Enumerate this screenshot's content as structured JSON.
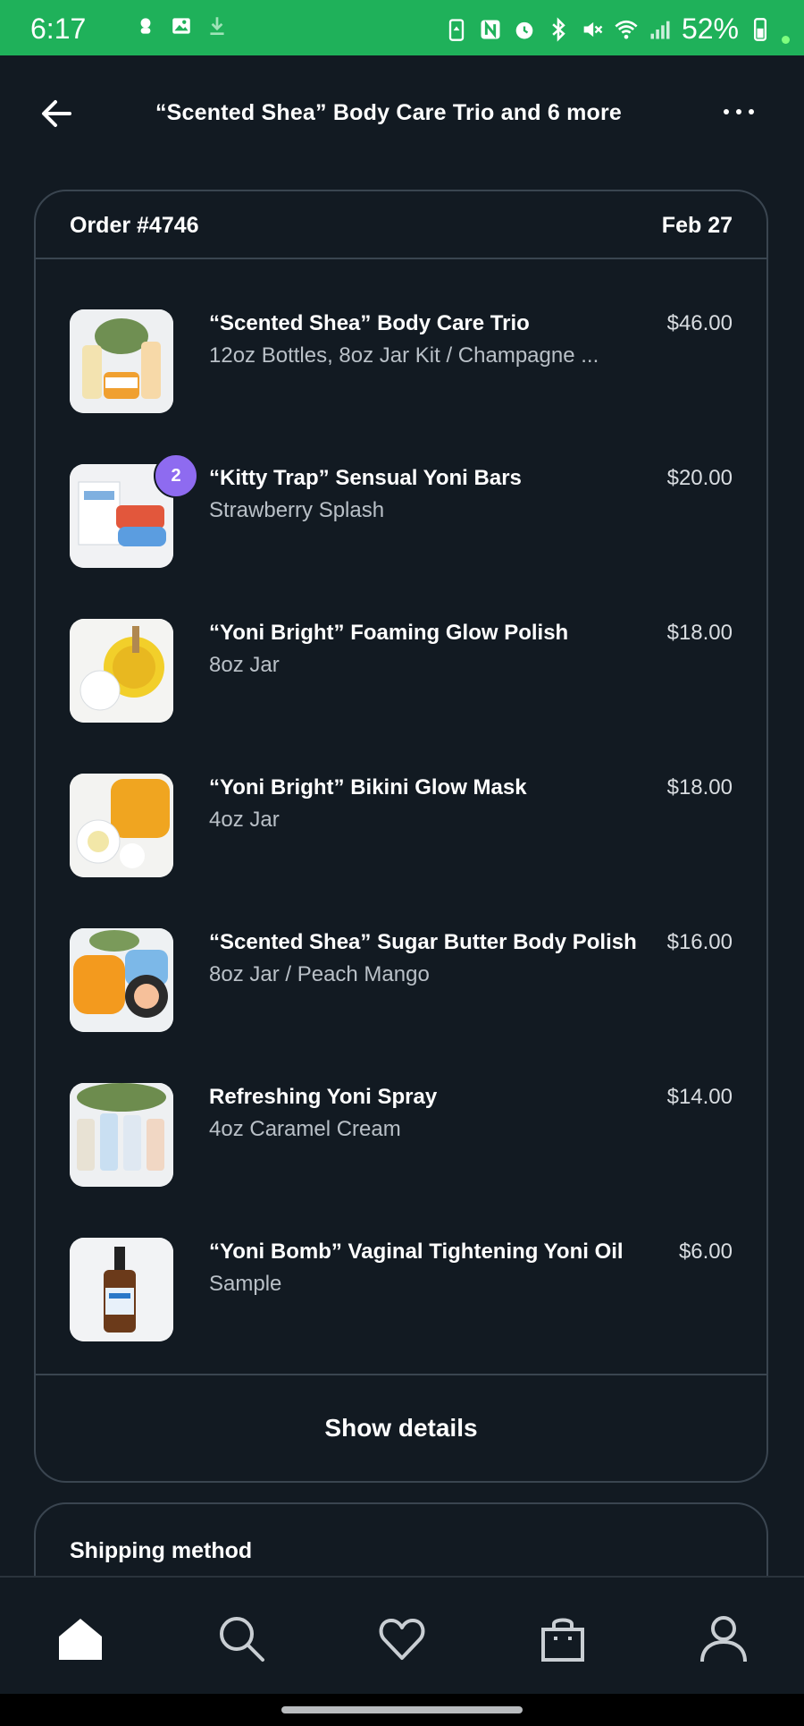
{
  "status_bar": {
    "time": "6:17",
    "battery": "52%"
  },
  "header": {
    "title": "“Scented Shea” Body Care Trio and 6 more"
  },
  "order": {
    "number": "Order #4746",
    "date": "Feb 27",
    "items": [
      {
        "name": "“Scented Shea” Body Care Trio",
        "variant": "12oz Bottles, 8oz Jar Kit / Champagne ...",
        "price": "$46.00"
      },
      {
        "name": "“Kitty Trap” Sensual Yoni Bars",
        "variant": "Strawberry Splash",
        "price": "$20.00",
        "quantity": "2"
      },
      {
        "name": "“Yoni Bright” Foaming Glow Polish",
        "variant": "8oz Jar",
        "price": "$18.00"
      },
      {
        "name": "“Yoni Bright” Bikini Glow Mask",
        "variant": "4oz Jar",
        "price": "$18.00"
      },
      {
        "name": "“Scented Shea” Sugar Butter Body Polish",
        "variant": "8oz Jar / Peach Mango",
        "price": "$16.00"
      },
      {
        "name": "Refreshing Yoni Spray",
        "variant": "4oz Caramel Cream",
        "price": "$14.00"
      },
      {
        "name": "“Yoni Bomb” Vaginal Tightening Yoni Oil",
        "variant": "Sample",
        "price": "$6.00"
      }
    ],
    "show_details_label": "Show details"
  },
  "shipping": {
    "label": "Shipping method"
  },
  "nav": {
    "items": [
      "home-icon",
      "search-icon",
      "heart-icon",
      "shopping-bag-icon",
      "profile-icon"
    ],
    "active": "home-icon"
  },
  "colors": {
    "background": "#121a22",
    "status_bar": "#1fb15a",
    "badge": "#8e6bf0",
    "border": "#3a4550"
  }
}
